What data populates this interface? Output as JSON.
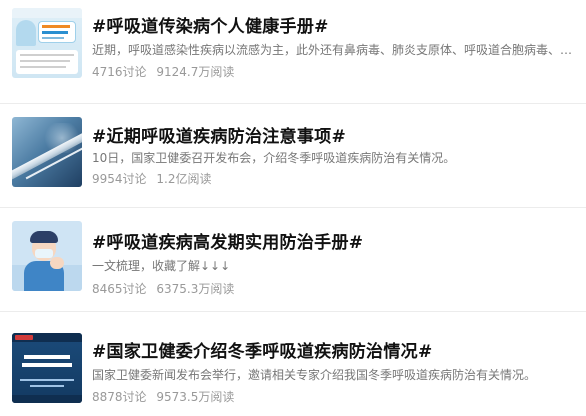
{
  "topics": [
    {
      "title": "#呼吸道传染病个人健康手册#",
      "description": "近期，呼吸道感染性疾病以流感为主，此外还有鼻病毒、肺炎支原体、呼吸道合胞病毒、腺…",
      "discussions": "4716讨论",
      "reads": "9124.7万阅读"
    },
    {
      "title": "#近期呼吸道疾病防治注意事项#",
      "description": "10日，国家卫健委召开发布会，介绍冬季呼吸道疾病防治有关情况。",
      "discussions": "9954讨论",
      "reads": "1.2亿阅读"
    },
    {
      "title": "#呼吸道疾病高发期实用防治手册#",
      "description": "一文梳理，收藏了解↓↓↓",
      "discussions": "8465讨论",
      "reads": "6375.3万阅读"
    },
    {
      "title": "#国家卫健委介绍冬季呼吸道疾病防治情况#",
      "description": "国家卫健委新闻发布会举行，邀请相关专家介绍我国冬季呼吸道疾病防治有关情况。",
      "discussions": "8878讨论",
      "reads": "9573.5万阅读"
    }
  ],
  "thumbnails": [
    "health-handbook-illustration-image",
    "thermometer-image",
    "masked-person-illustration-image",
    "press-conference-poster-image"
  ]
}
